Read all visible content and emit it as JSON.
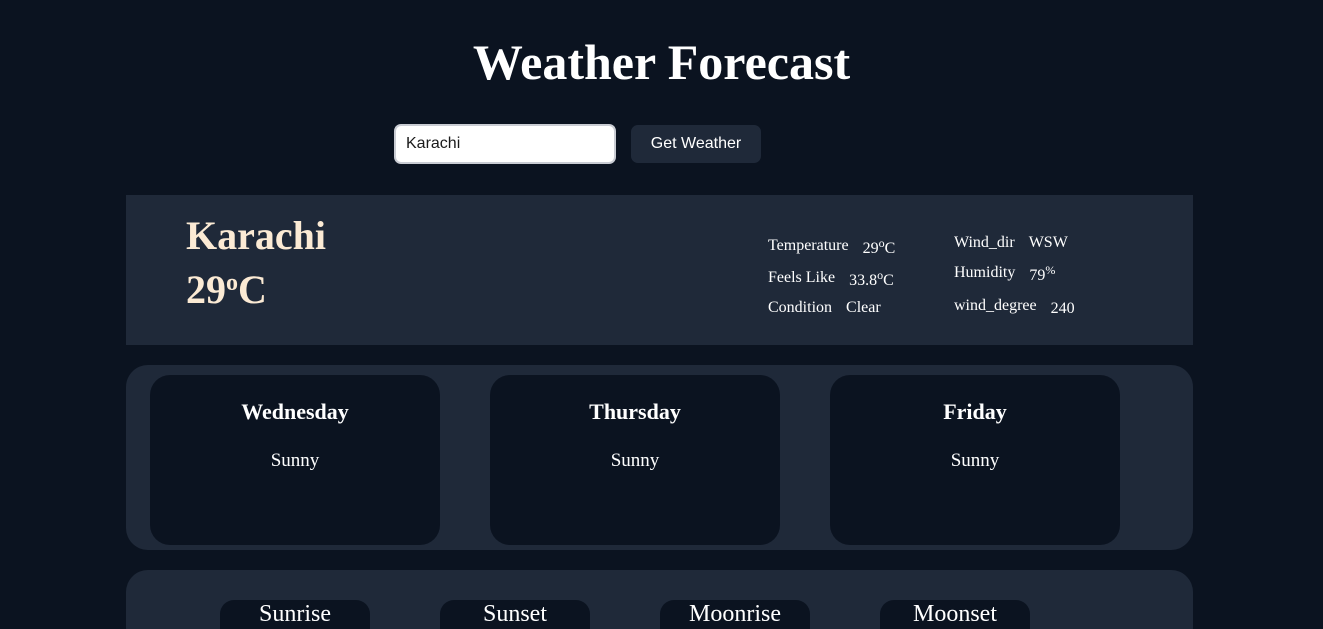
{
  "header": {
    "title": "Weather Forecast"
  },
  "search": {
    "value": "Karachi",
    "button_label": "Get Weather"
  },
  "current": {
    "city": "Karachi",
    "temp_value": "29",
    "temp_degree_symbol": "o",
    "temp_unit": "C",
    "details_left": [
      {
        "label": "Temperature",
        "value": "29",
        "sup": "o",
        "unit": "C"
      },
      {
        "label": "Feels Like",
        "value": "33.8",
        "sup": "o",
        "unit": "C"
      },
      {
        "label": "Condition",
        "value": "Clear",
        "sup": "",
        "unit": ""
      }
    ],
    "details_right": [
      {
        "label": "Wind_dir",
        "value": "WSW",
        "sup": "",
        "unit": ""
      },
      {
        "label": "Humidity",
        "value": "79",
        "sup": "%",
        "unit": ""
      },
      {
        "label": "wind_degree",
        "value": "240",
        "sup": "",
        "unit": ""
      }
    ]
  },
  "forecast": [
    {
      "day": "Wednesday",
      "condition": "Sunny"
    },
    {
      "day": "Thursday",
      "condition": "Sunny"
    },
    {
      "day": "Friday",
      "condition": "Sunny"
    }
  ],
  "astro": [
    {
      "label": "Sunrise"
    },
    {
      "label": "Sunset"
    },
    {
      "label": "Moonrise"
    },
    {
      "label": "Moonset"
    }
  ]
}
